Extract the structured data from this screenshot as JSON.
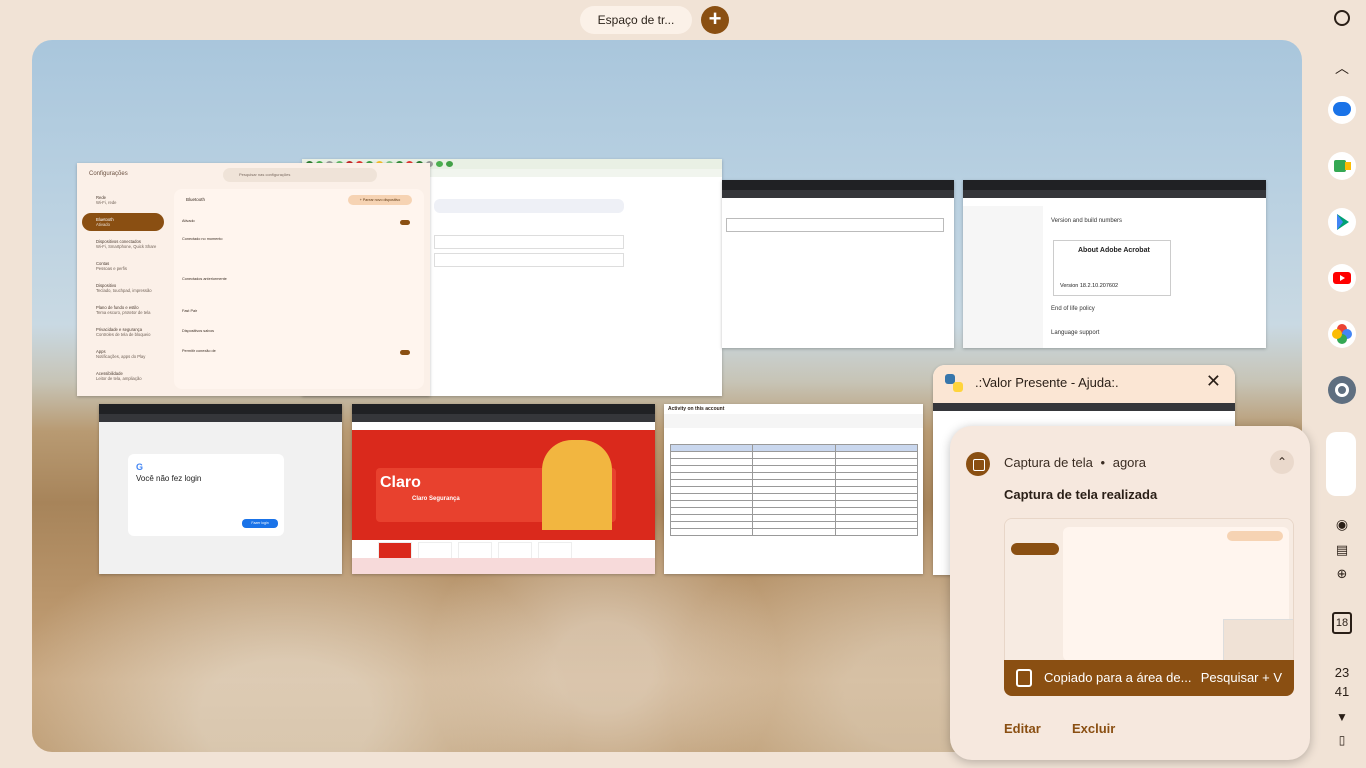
{
  "desks": {
    "current": "Espaço de tr...",
    "add_label": "+"
  },
  "settings_window": {
    "title": "Configurações",
    "search_placeholder": "Pesquisar nas configurações",
    "nav": [
      {
        "label": "Rede",
        "sub": "Wi-Fi, rede",
        "active": false
      },
      {
        "label": "Bluetooth",
        "sub": "Ativado",
        "active": true
      },
      {
        "label": "Dispositivos conectados",
        "sub": "Wi-Fi, Smartphone, Quick Share",
        "active": false
      },
      {
        "label": "Contas",
        "sub": "Pessoas e perfis",
        "active": false
      },
      {
        "label": "Dispositivo",
        "sub": "Teclado, touchpad, impressão",
        "active": false
      },
      {
        "label": "Plano de fundo e estilo",
        "sub": "Tema escuro, protetor de tela",
        "active": false
      },
      {
        "label": "Privacidade e segurança",
        "sub": "Controles de tela de bloqueio",
        "active": false
      },
      {
        "label": "Apps",
        "sub": "Notificações, apps do Play",
        "active": false
      },
      {
        "label": "Acessibilidade",
        "sub": "Leitor de tela, ampliação",
        "active": false
      }
    ],
    "panel_title": "Bluetooth",
    "pair_button": "+ Parear novo dispositivo",
    "rows": [
      "Ativado",
      "Conectado no momento",
      "Conectados anteriormente",
      "Fast Pair",
      "Dispositivos salvos",
      "Permitir conexão de"
    ]
  },
  "adobe_window": {
    "heading": "Version and build numbers",
    "card_title": "About Adobe Acrobat",
    "card_version": "Version 18.2.10.207602",
    "end_policy": "End of life policy",
    "lang": "Language support"
  },
  "google_window": {
    "logo": "G",
    "title": "Você não fez login",
    "button": "Fazer login"
  },
  "claro_window": {
    "brand": "Claro",
    "headline": "Claro Segurança"
  },
  "activity_window": {
    "title": "Activity on this account"
  },
  "python_help_window": {
    "title": ".:Valor Presente - Ajuda:.",
    "close": "✕"
  },
  "notification": {
    "app": "Captura de tela",
    "dot": "•",
    "time": "agora",
    "title": "Captura de tela realizada",
    "copied_text": "Copiado para a área de...",
    "shortcut": "Pesquisar + V",
    "actions": [
      "Editar",
      "Excluir"
    ]
  },
  "status": {
    "date": "18",
    "hour": "23",
    "minute": "41"
  },
  "shelf_apps": [
    "launcher-icon",
    "expand-icon",
    "messages-icon",
    "meet-icon",
    "play-store-icon",
    "youtube-icon",
    "photos-icon",
    "settings-icon",
    "file-icon",
    "screen-capture-icon",
    "tote-icon",
    "add-icon",
    "calendar-icon",
    "wifi-icon",
    "battery-icon"
  ],
  "colors": {
    "accent": "#8a4f12",
    "background": "#f1e3d6",
    "claro_red": "#da291c"
  }
}
